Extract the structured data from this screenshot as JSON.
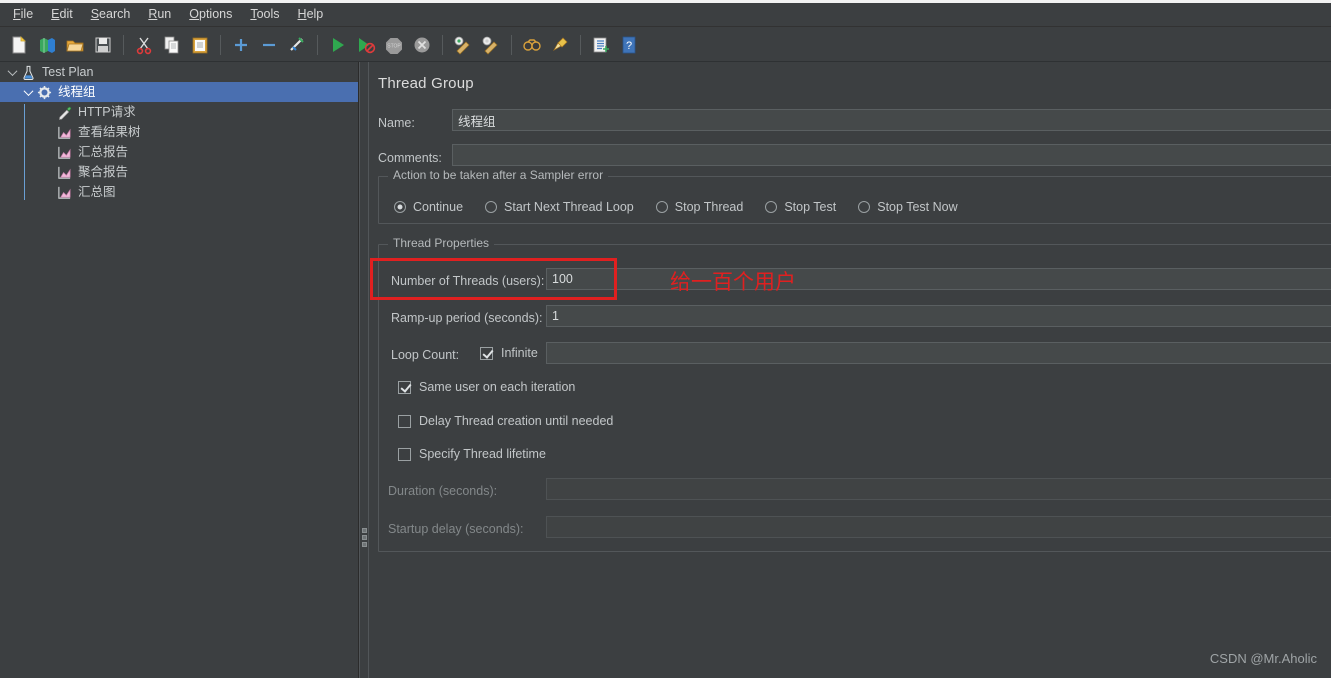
{
  "menu": {
    "items": [
      {
        "label": "File",
        "mnemonic": "F"
      },
      {
        "label": "Edit",
        "mnemonic": "E"
      },
      {
        "label": "Search",
        "mnemonic": "S"
      },
      {
        "label": "Run",
        "mnemonic": "R"
      },
      {
        "label": "Options",
        "mnemonic": "O"
      },
      {
        "label": "Tools",
        "mnemonic": "T"
      },
      {
        "label": "Help",
        "mnemonic": "H"
      }
    ]
  },
  "toolbar": {
    "buttons": [
      {
        "name": "new-icon",
        "title": "New"
      },
      {
        "name": "templates-icon",
        "title": "Templates"
      },
      {
        "name": "open-icon",
        "title": "Open"
      },
      {
        "name": "save-icon",
        "title": "Save"
      },
      {
        "name": "cut-icon",
        "title": "Cut"
      },
      {
        "name": "copy-icon",
        "title": "Copy"
      },
      {
        "name": "paste-icon",
        "title": "Paste"
      },
      {
        "name": "expand-all-icon",
        "title": "Expand All"
      },
      {
        "name": "collapse-all-icon",
        "title": "Collapse All"
      },
      {
        "name": "toggle-icon",
        "title": "Toggle"
      },
      {
        "name": "start-icon",
        "title": "Start"
      },
      {
        "name": "start-no-pause-icon",
        "title": "Start no pauses"
      },
      {
        "name": "stop-icon",
        "title": "Stop"
      },
      {
        "name": "shutdown-icon",
        "title": "Shutdown"
      },
      {
        "name": "clear-icon",
        "title": "Clear"
      },
      {
        "name": "clear-all-icon",
        "title": "Clear All"
      },
      {
        "name": "search-icon",
        "title": "Search"
      },
      {
        "name": "reset-search-icon",
        "title": "Reset Search"
      },
      {
        "name": "function-helper-icon",
        "title": "Function Helper Dialog"
      },
      {
        "name": "help-icon",
        "title": "Help"
      }
    ]
  },
  "tree": {
    "items": [
      {
        "label": "Test Plan",
        "icon": "test-plan-icon",
        "depth": 0,
        "expanded": true,
        "selected": false
      },
      {
        "label": "线程组",
        "icon": "thread-group-icon",
        "depth": 1,
        "expanded": true,
        "selected": true
      },
      {
        "label": "HTTP请求",
        "icon": "http-request-icon",
        "depth": 2,
        "expanded": false,
        "selected": false
      },
      {
        "label": "查看结果树",
        "icon": "view-results-tree-icon",
        "depth": 2,
        "expanded": false,
        "selected": false
      },
      {
        "label": "汇总报告",
        "icon": "summary-report-icon",
        "depth": 2,
        "expanded": false,
        "selected": false
      },
      {
        "label": "聚合报告",
        "icon": "aggregate-report-icon",
        "depth": 2,
        "expanded": false,
        "selected": false
      },
      {
        "label": "汇总图",
        "icon": "summary-graph-icon",
        "depth": 2,
        "expanded": false,
        "selected": false
      }
    ]
  },
  "panel": {
    "title": "Thread Group",
    "name_label": "Name:",
    "name_value": "线程组",
    "comments_label": "Comments:",
    "comments_value": "",
    "sampler_error": {
      "legend": "Action to be taken after a Sampler error",
      "options": [
        {
          "label": "Continue",
          "selected": true
        },
        {
          "label": "Start Next Thread Loop",
          "selected": false
        },
        {
          "label": "Stop Thread",
          "selected": false
        },
        {
          "label": "Stop Test",
          "selected": false
        },
        {
          "label": "Stop Test Now",
          "selected": false
        }
      ]
    },
    "thread_properties": {
      "legend": "Thread Properties",
      "num_threads_label": "Number of Threads (users):",
      "num_threads_value": "100",
      "ramp_up_label": "Ramp-up period (seconds):",
      "ramp_up_value": "1",
      "loop_count_label": "Loop Count:",
      "infinite_label": "Infinite",
      "infinite_checked": true,
      "loop_count_value": "",
      "same_user_label": "Same user on each iteration",
      "same_user_checked": true,
      "delay_thread_label": "Delay Thread creation until needed",
      "delay_thread_checked": false,
      "specify_lifetime_label": "Specify Thread lifetime",
      "specify_lifetime_checked": false,
      "duration_label": "Duration (seconds):",
      "duration_value": "",
      "startup_delay_label": "Startup delay (seconds):",
      "startup_delay_value": ""
    }
  },
  "annotation": {
    "text": "给一百个用户",
    "color": "#e02020"
  },
  "watermark": {
    "text": "CSDN @Mr.Aholic"
  }
}
